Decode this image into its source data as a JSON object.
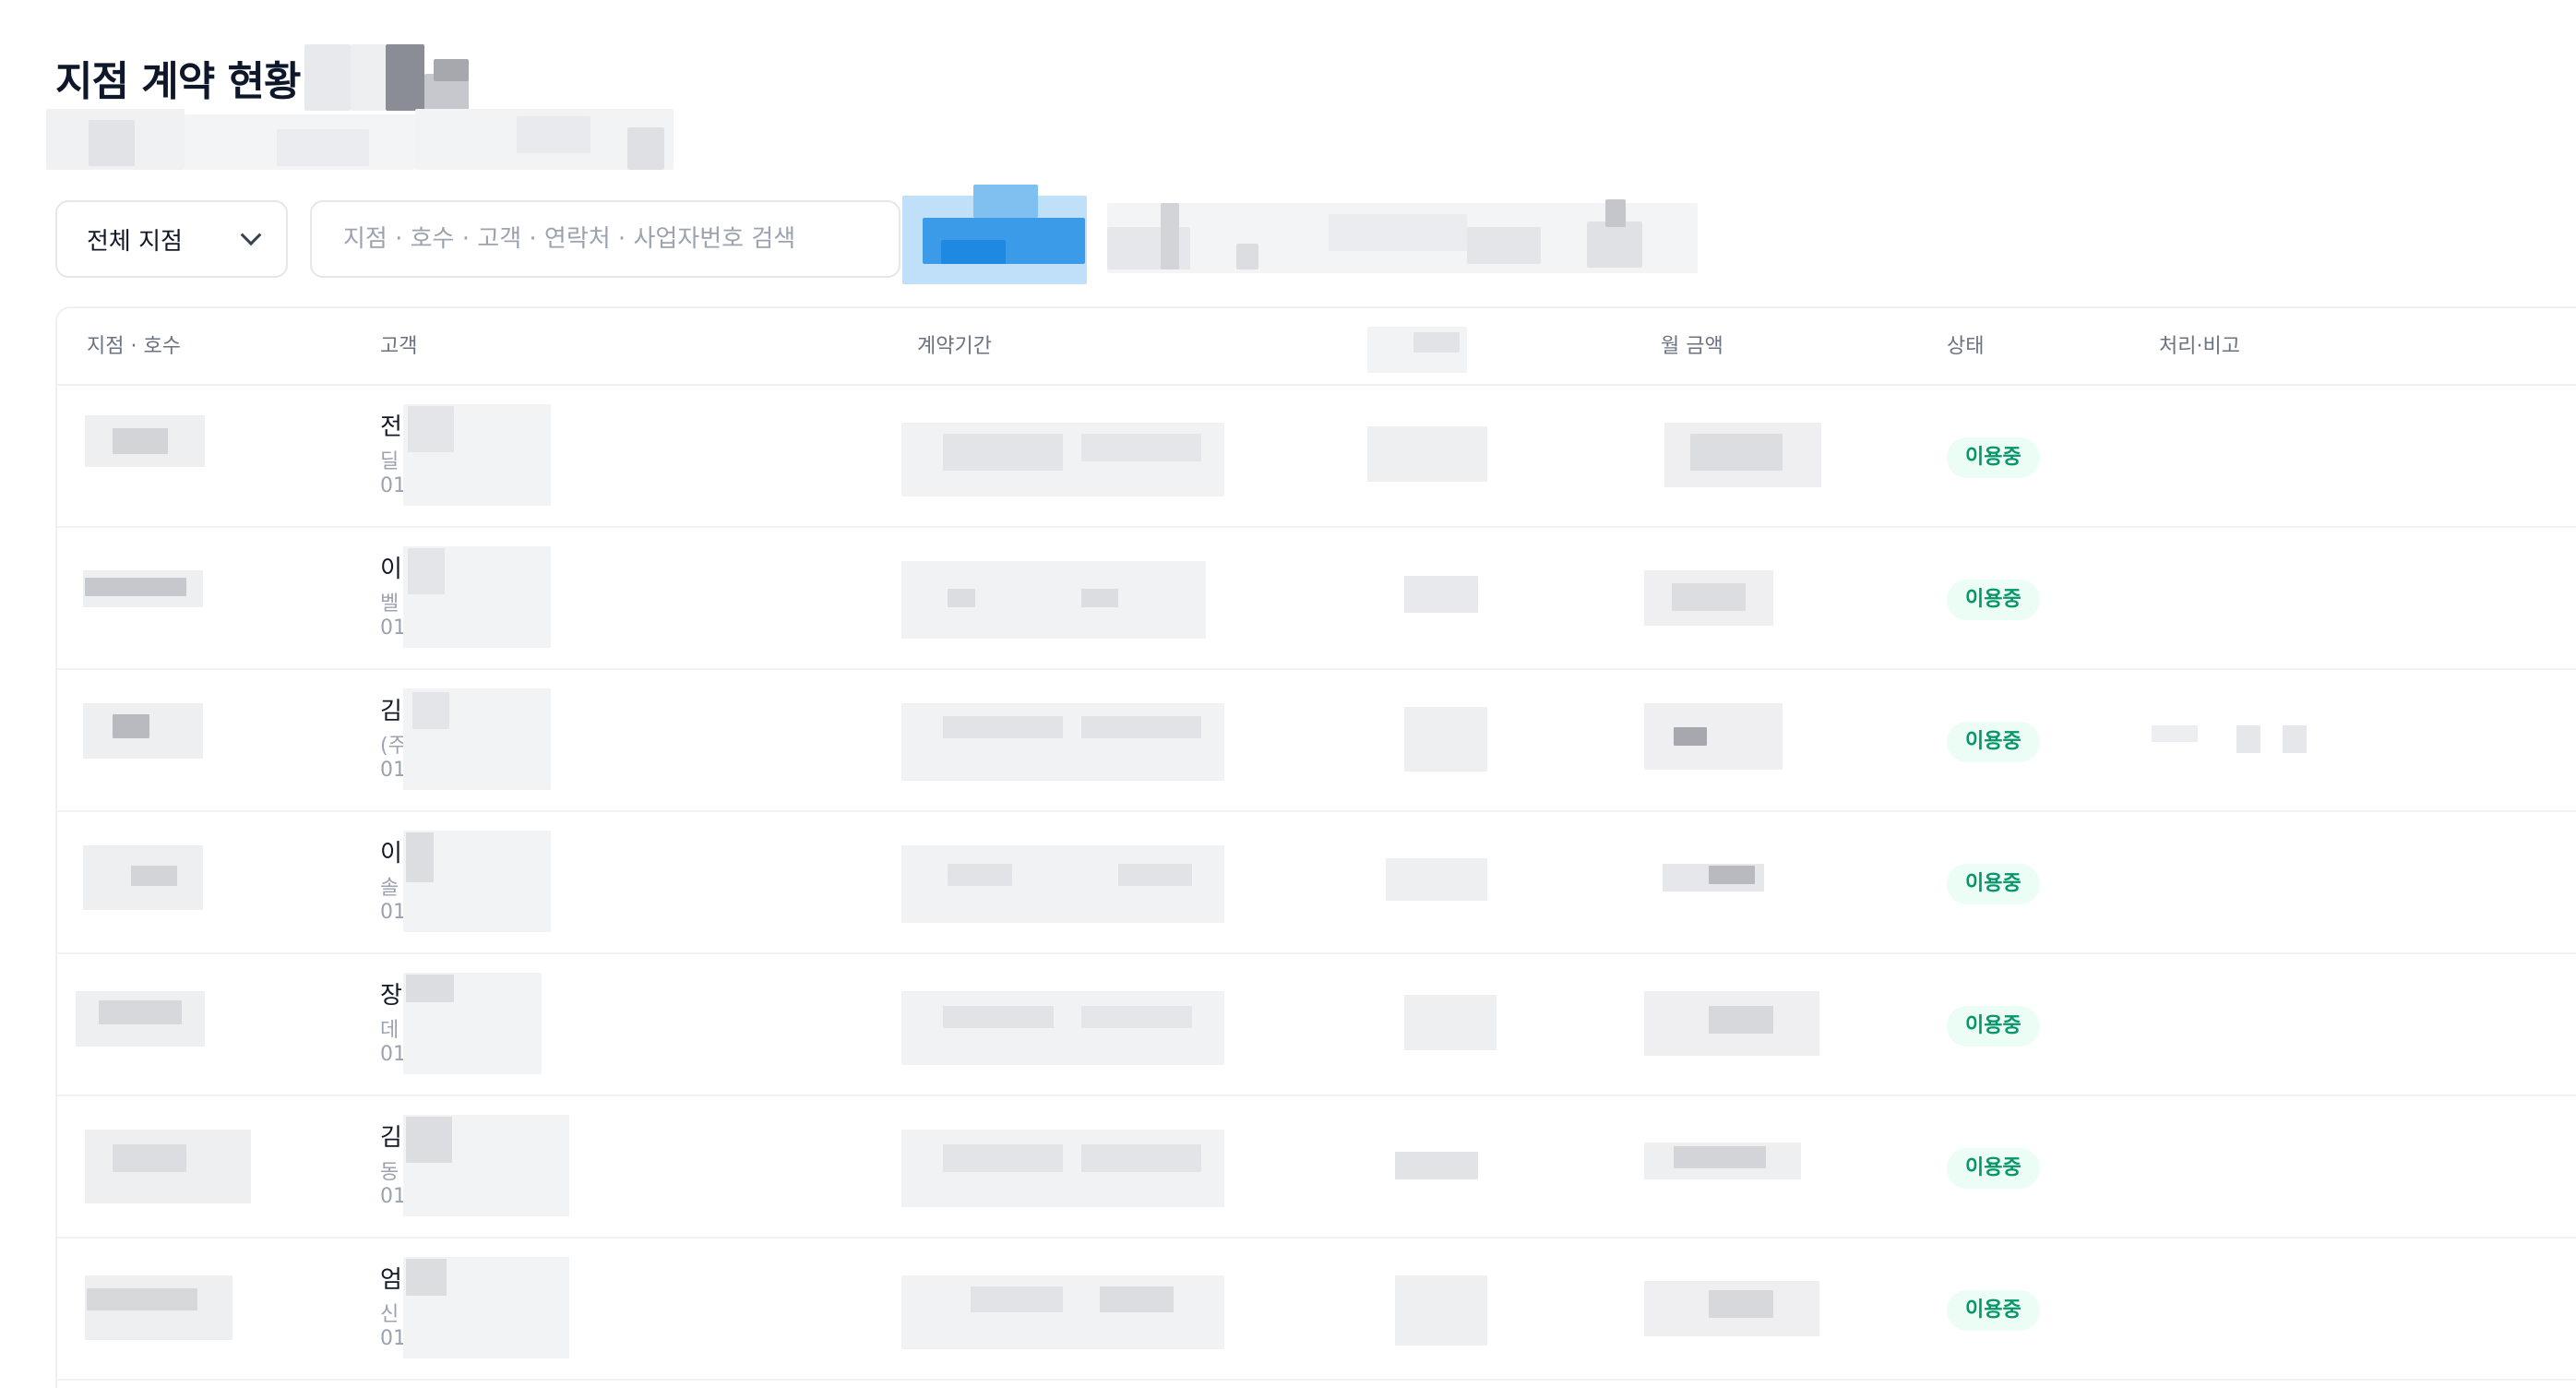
{
  "page": {
    "title": "지점 계약 현황"
  },
  "filters": {
    "branch_select": {
      "value": "전체 지점"
    },
    "search": {
      "placeholder": "지점 · 호수 · 고객 · 연락처 · 사업자번호 검색"
    }
  },
  "table": {
    "headers": {
      "branch_unit": "지점 · 호수",
      "customer": "고객",
      "period": "계약기간",
      "monthly_amount": "월 금액",
      "status": "상태",
      "notes": "처리·비고"
    },
    "rows": [
      {
        "customer_name": "전",
        "customer_sub": "딜",
        "customer_phone": "01",
        "status": "이용중"
      },
      {
        "customer_name": "이",
        "customer_sub": "벨",
        "customer_phone": "01",
        "status": "이용중"
      },
      {
        "customer_name": "김",
        "customer_sub": "(주",
        "customer_phone": "01",
        "status": "이용중"
      },
      {
        "customer_name": "이",
        "customer_sub": "솔",
        "customer_phone": "01",
        "status": "이용중"
      },
      {
        "customer_name": "장",
        "customer_sub": "데",
        "customer_phone": "01",
        "status": "이용중"
      },
      {
        "customer_name": "김",
        "customer_sub": "동",
        "customer_phone": "01",
        "status": "이용중"
      },
      {
        "customer_name": "엄",
        "customer_sub": "신",
        "customer_phone": "01",
        "status": "이용중"
      }
    ]
  },
  "colors": {
    "status_bg": "#ecfdf5",
    "status_text": "#059669",
    "accent_blue": "#3b9be8"
  }
}
